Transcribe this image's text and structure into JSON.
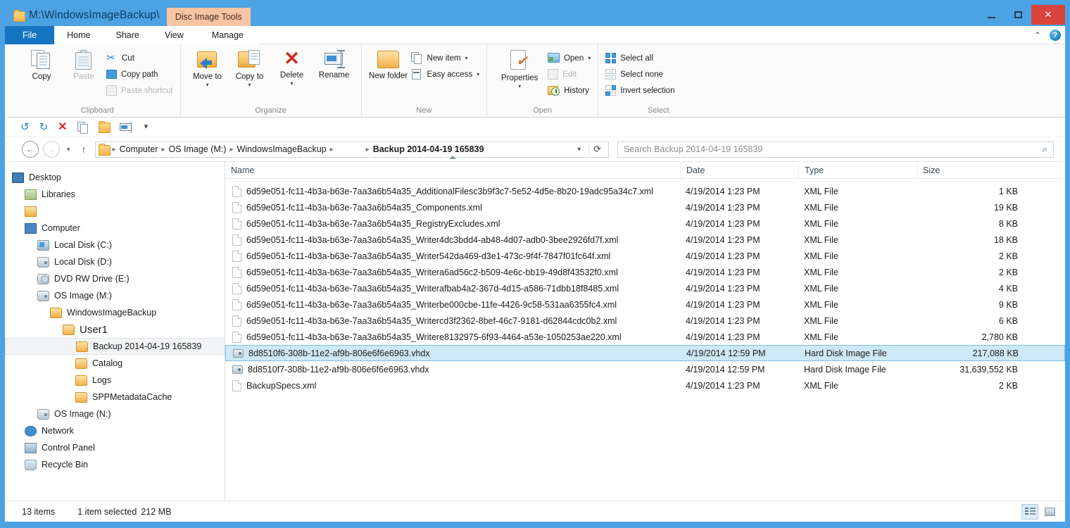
{
  "window": {
    "title": "M:\\WindowsImageBackup\\",
    "contextual_tab": "Disc Image Tools",
    "minimize_label": "Minimize",
    "maximize_label": "Maximize",
    "close_label": "Close",
    "folder_icon": "folder-icon"
  },
  "ribbon": {
    "tabs": [
      {
        "label": "File",
        "active": true
      },
      {
        "label": "Home"
      },
      {
        "label": "Share"
      },
      {
        "label": "View"
      },
      {
        "label": "Manage"
      }
    ],
    "collapse_icon": "chevron-up-icon",
    "help_icon": "help-icon",
    "help_glyph": "?",
    "groups": {
      "clipboard": {
        "label": "Clipboard",
        "copy": "Copy",
        "paste": "Paste",
        "cut": "Cut",
        "copy_path": "Copy path",
        "paste_shortcut": "Paste shortcut"
      },
      "organize": {
        "label": "Organize",
        "move_to": "Move to",
        "copy_to": "Copy to",
        "delete": "Delete",
        "rename": "Rename"
      },
      "new": {
        "label": "New",
        "new_folder": "New folder",
        "new_item": "New item",
        "easy_access": "Easy access"
      },
      "open": {
        "label": "Open",
        "properties": "Properties",
        "open": "Open",
        "edit": "Edit",
        "history": "History"
      },
      "select": {
        "label": "Select",
        "select_all": "Select all",
        "select_none": "Select none",
        "invert_selection": "Invert selection"
      }
    }
  },
  "quick_access": {
    "undo": "undo-icon",
    "redo": "redo-icon",
    "delete": "delete-icon",
    "properties": "properties-icon",
    "new_folder": "new-folder-icon",
    "rename": "rename-icon",
    "customize": "chevron-down-icon"
  },
  "addressbar": {
    "back": "back-icon",
    "forward": "forward-icon",
    "recent": "chevron-down-icon",
    "up": "up-icon",
    "breadcrumbs": [
      "Computer",
      "OS Image (M:)",
      "WindowsImageBackup"
    ],
    "current": "Backup 2014-04-19 165839",
    "dropdown": "chevron-down-icon",
    "refresh": "refresh-icon",
    "search_placeholder": "Search Backup 2014-04-19 165839",
    "search_value": "",
    "search_icon": "search-icon"
  },
  "navigation": {
    "items": [
      {
        "label": "Desktop",
        "icon": "ni-monitor",
        "indent": 0
      },
      {
        "label": "Libraries",
        "icon": "ni-lib",
        "indent": 1
      },
      {
        "label": "",
        "icon": "ni-user",
        "indent": 1
      },
      {
        "label": "Computer",
        "icon": "ni-comp",
        "indent": 1
      },
      {
        "label": "Local Disk (C:)",
        "icon": "ni-cdrive",
        "indent": 2
      },
      {
        "label": "Local Disk (D:)",
        "icon": "ni-drive",
        "indent": 2
      },
      {
        "label": "DVD RW Drive (E:)",
        "icon": "ni-dvd",
        "indent": 2
      },
      {
        "label": "OS Image (M:)",
        "icon": "ni-drive",
        "indent": 2
      },
      {
        "label": "WindowsImageBackup",
        "icon": "ni-folder",
        "indent": 3
      },
      {
        "label": "User1",
        "icon": "ni-folder",
        "indent": 4,
        "big": true
      },
      {
        "label": "Backup 2014-04-19 165839",
        "icon": "ni-folder",
        "indent": 5,
        "selected": true
      },
      {
        "label": "Catalog",
        "icon": "ni-folder",
        "indent": 5
      },
      {
        "label": "Logs",
        "icon": "ni-folder",
        "indent": 5
      },
      {
        "label": "SPPMetadataCache",
        "icon": "ni-folder",
        "indent": 5
      },
      {
        "label": "OS Image (N:)",
        "icon": "ni-drive",
        "indent": 2
      },
      {
        "label": "Network",
        "icon": "ni-net",
        "indent": 1
      },
      {
        "label": "Control Panel",
        "icon": "ni-cp",
        "indent": 1
      },
      {
        "label": "Recycle Bin",
        "icon": "ni-bin",
        "indent": 1
      }
    ]
  },
  "filelist": {
    "columns": [
      "Name",
      "Date",
      "Type",
      "Size"
    ],
    "sort_column": "Name",
    "sort_direction": "ascending",
    "rows": [
      {
        "name": "6d59e051-fc11-4b3a-b63e-7aa3a6b54a35_AdditionalFilesc3b9f3c7-5e52-4d5e-8b20-19adc95a34c7.xml",
        "date": "4/19/2014 1:23 PM",
        "type": "XML File",
        "size": "1 KB",
        "icon": "xml-file-icon"
      },
      {
        "name": "6d59e051-fc11-4b3a-b63e-7aa3a6b54a35_Components.xml",
        "date": "4/19/2014 1:23 PM",
        "type": "XML File",
        "size": "19 KB",
        "icon": "xml-file-icon"
      },
      {
        "name": "6d59e051-fc11-4b3a-b63e-7aa3a6b54a35_RegistryExcludes.xml",
        "date": "4/19/2014 1:23 PM",
        "type": "XML File",
        "size": "8 KB",
        "icon": "xml-file-icon"
      },
      {
        "name": "6d59e051-fc11-4b3a-b63e-7aa3a6b54a35_Writer4dc3bdd4-ab48-4d07-adb0-3bee2926fd7f.xml",
        "date": "4/19/2014 1:23 PM",
        "type": "XML File",
        "size": "18 KB",
        "icon": "xml-file-icon"
      },
      {
        "name": "6d59e051-fc11-4b3a-b63e-7aa3a6b54a35_Writer542da469-d3e1-473c-9f4f-7847f01fc64f.xml",
        "date": "4/19/2014 1:23 PM",
        "type": "XML File",
        "size": "2 KB",
        "icon": "xml-file-icon"
      },
      {
        "name": "6d59e051-fc11-4b3a-b63e-7aa3a6b54a35_Writera6ad56c2-b509-4e6c-bb19-49d8f43532f0.xml",
        "date": "4/19/2014 1:23 PM",
        "type": "XML File",
        "size": "2 KB",
        "icon": "xml-file-icon"
      },
      {
        "name": "6d59e051-fc11-4b3a-b63e-7aa3a6b54a35_Writerafbab4a2-367d-4d15-a586-71dbb18f8485.xml",
        "date": "4/19/2014 1:23 PM",
        "type": "XML File",
        "size": "4 KB",
        "icon": "xml-file-icon"
      },
      {
        "name": "6d59e051-fc11-4b3a-b63e-7aa3a6b54a35_Writerbe000cbe-11fe-4426-9c58-531aa6355fc4.xml",
        "date": "4/19/2014 1:23 PM",
        "type": "XML File",
        "size": "9 KB",
        "icon": "xml-file-icon"
      },
      {
        "name": "6d59e051-fc11-4b3a-b63e-7aa3a6b54a35_Writercd3f2362-8bef-46c7-9181-d62844cdc0b2.xml",
        "date": "4/19/2014 1:23 PM",
        "type": "XML File",
        "size": "6 KB",
        "icon": "xml-file-icon"
      },
      {
        "name": "6d59e051-fc11-4b3a-b63e-7aa3a6b54a35_Writere8132975-6f93-4464-a53e-1050253ae220.xml",
        "date": "4/19/2014 1:23 PM",
        "type": "XML File",
        "size": "2,780 KB",
        "icon": "xml-file-icon"
      },
      {
        "name": "8d8510f6-308b-11e2-af9b-806e6f6e6963.vhdx",
        "date": "4/19/2014 12:59 PM",
        "type": "Hard Disk Image File",
        "size": "217,088 KB",
        "icon": "vhdx-file-icon",
        "selected": true
      },
      {
        "name": "8d8510f7-308b-11e2-af9b-806e6f6e6963.vhdx",
        "date": "4/19/2014 12:59 PM",
        "type": "Hard Disk Image File",
        "size": "31,639,552 KB",
        "icon": "vhdx-file-icon"
      },
      {
        "name": "BackupSpecs.xml",
        "date": "4/19/2014 1:23 PM",
        "type": "XML File",
        "size": "2 KB",
        "icon": "xml-file-icon"
      }
    ]
  },
  "status": {
    "item_count": "13 items",
    "selection": "1 item selected",
    "selection_size": "212 MB",
    "details_view": "details-view-icon",
    "tiles_view": "tiles-view-icon"
  },
  "colors": {
    "accent": "#4ba3e3",
    "file_tab": "#1675c0",
    "contextual_tab": "#f8c4a4",
    "selection": "#cfe8f7",
    "close_button": "#d9453d"
  }
}
